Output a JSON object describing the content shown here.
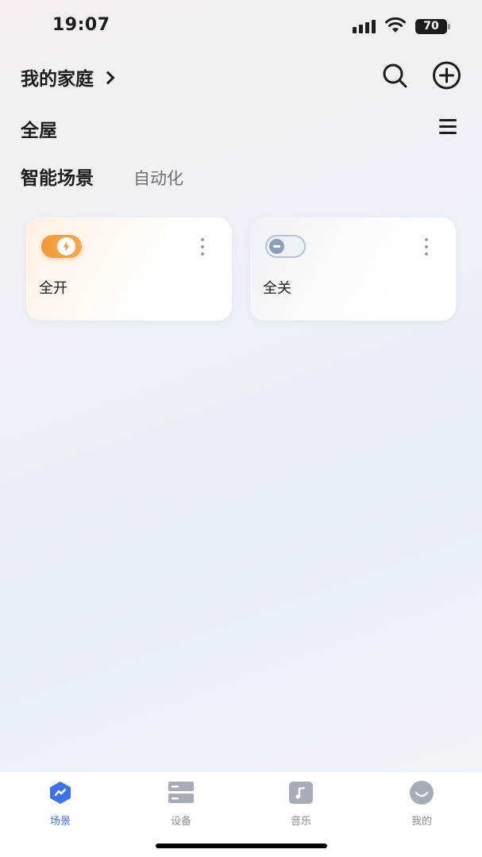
{
  "status_bar": {
    "time": "19:07",
    "battery": "70"
  },
  "header": {
    "home_title": "我的家庭",
    "room_title": "全屋"
  },
  "tabs": {
    "active": "智能场景",
    "inactive": "自动化"
  },
  "scenes": [
    {
      "label": "全开",
      "state": "on"
    },
    {
      "label": "全关",
      "state": "off"
    }
  ],
  "bottom_nav": [
    {
      "label": "场景",
      "icon": "scene-icon",
      "active": true
    },
    {
      "label": "设备",
      "icon": "device-icon",
      "active": false
    },
    {
      "label": "音乐",
      "icon": "music-icon",
      "active": false
    },
    {
      "label": "我的",
      "icon": "profile-icon",
      "active": false
    }
  ],
  "colors": {
    "accent": "#3c73e8",
    "toggle_on": "#f29a39",
    "toggle_off": "#8da0bb"
  }
}
